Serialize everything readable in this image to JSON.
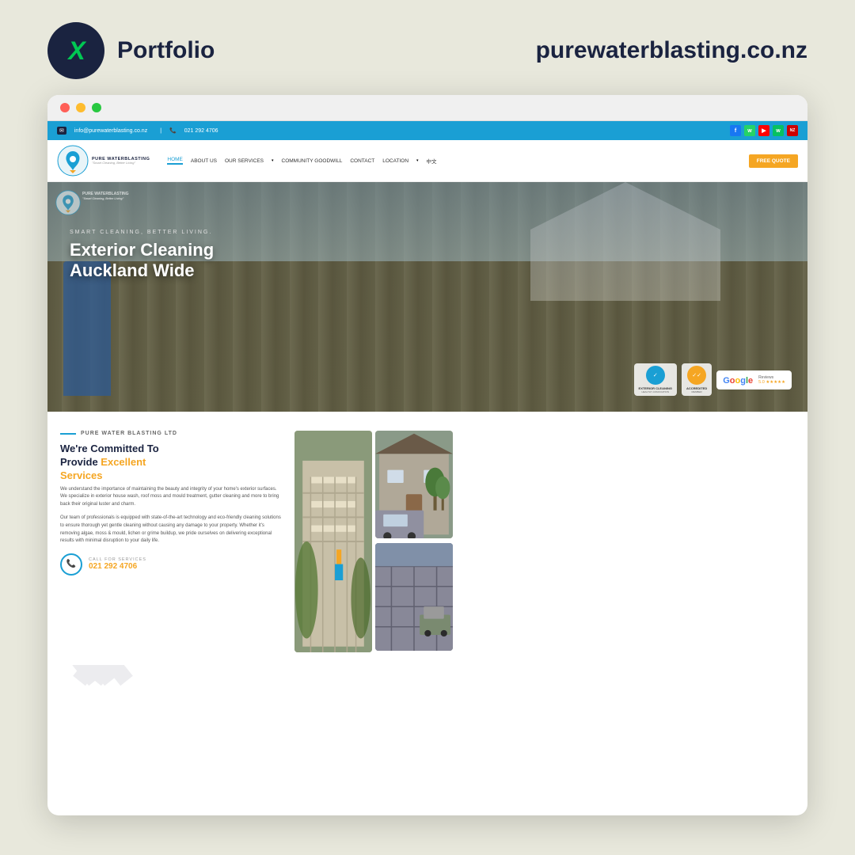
{
  "header": {
    "logo_letter": "X",
    "portfolio_label": "Portfolio",
    "domain": "purewaterblasting.co.nz"
  },
  "browser": {
    "dots": [
      "dot1",
      "dot2",
      "dot3"
    ]
  },
  "website": {
    "top_bar": {
      "email": "info@purewaterblasting.co.nz",
      "phone": "021 292 4706",
      "social": [
        "f",
        "w",
        "y",
        "w",
        "nz"
      ]
    },
    "nav": {
      "logo_name": "PURE WATERBLASTING",
      "logo_tagline": "Smart Cleaning, Better Living",
      "links": [
        "HOME",
        "ABOUT US",
        "OUR SERVICES",
        "COMMUNITY GOODWILL",
        "CONTACT",
        "LOCATION",
        "中文"
      ],
      "active_link": "HOME",
      "cta_button": "FREE QUOTE"
    },
    "hero": {
      "subtitle": "SMART CLEANING, BETTER LIVING.",
      "title_line1": "Exterior Cleaning",
      "title_line2": "Auckland Wide",
      "badge_google": "Google",
      "badge_reviews": "Reviews",
      "badge_stars": "5.0 ★★★★★"
    },
    "content": {
      "company_tag": "PURE WATER BLASTING LTD",
      "committed_line1": "We're Committed To",
      "committed_line2": "Provide ",
      "committed_highlight": "Excellent",
      "committed_line3": "Services",
      "desc1": "We understand the importance of maintaining the beauty and integrity of your home's exterior surfaces. We specialize in exterior house wash, roof moss and mould treatment, gutter cleaning and more to bring back their original luster and charm.",
      "desc2": "Our team of professionals is equipped with state-of-the-art technology and eco-friendly cleaning solutions to ensure thorough yet gentle cleaning without causing any damage to your property. Whether it's removing algae, moss & mould, lichen or grime buildup, we pride ourselves on delivering exceptional results with minimal disruption to your daily life.",
      "call_label": "CALL FOR SERVICES",
      "call_number": "021 292 4706"
    }
  }
}
